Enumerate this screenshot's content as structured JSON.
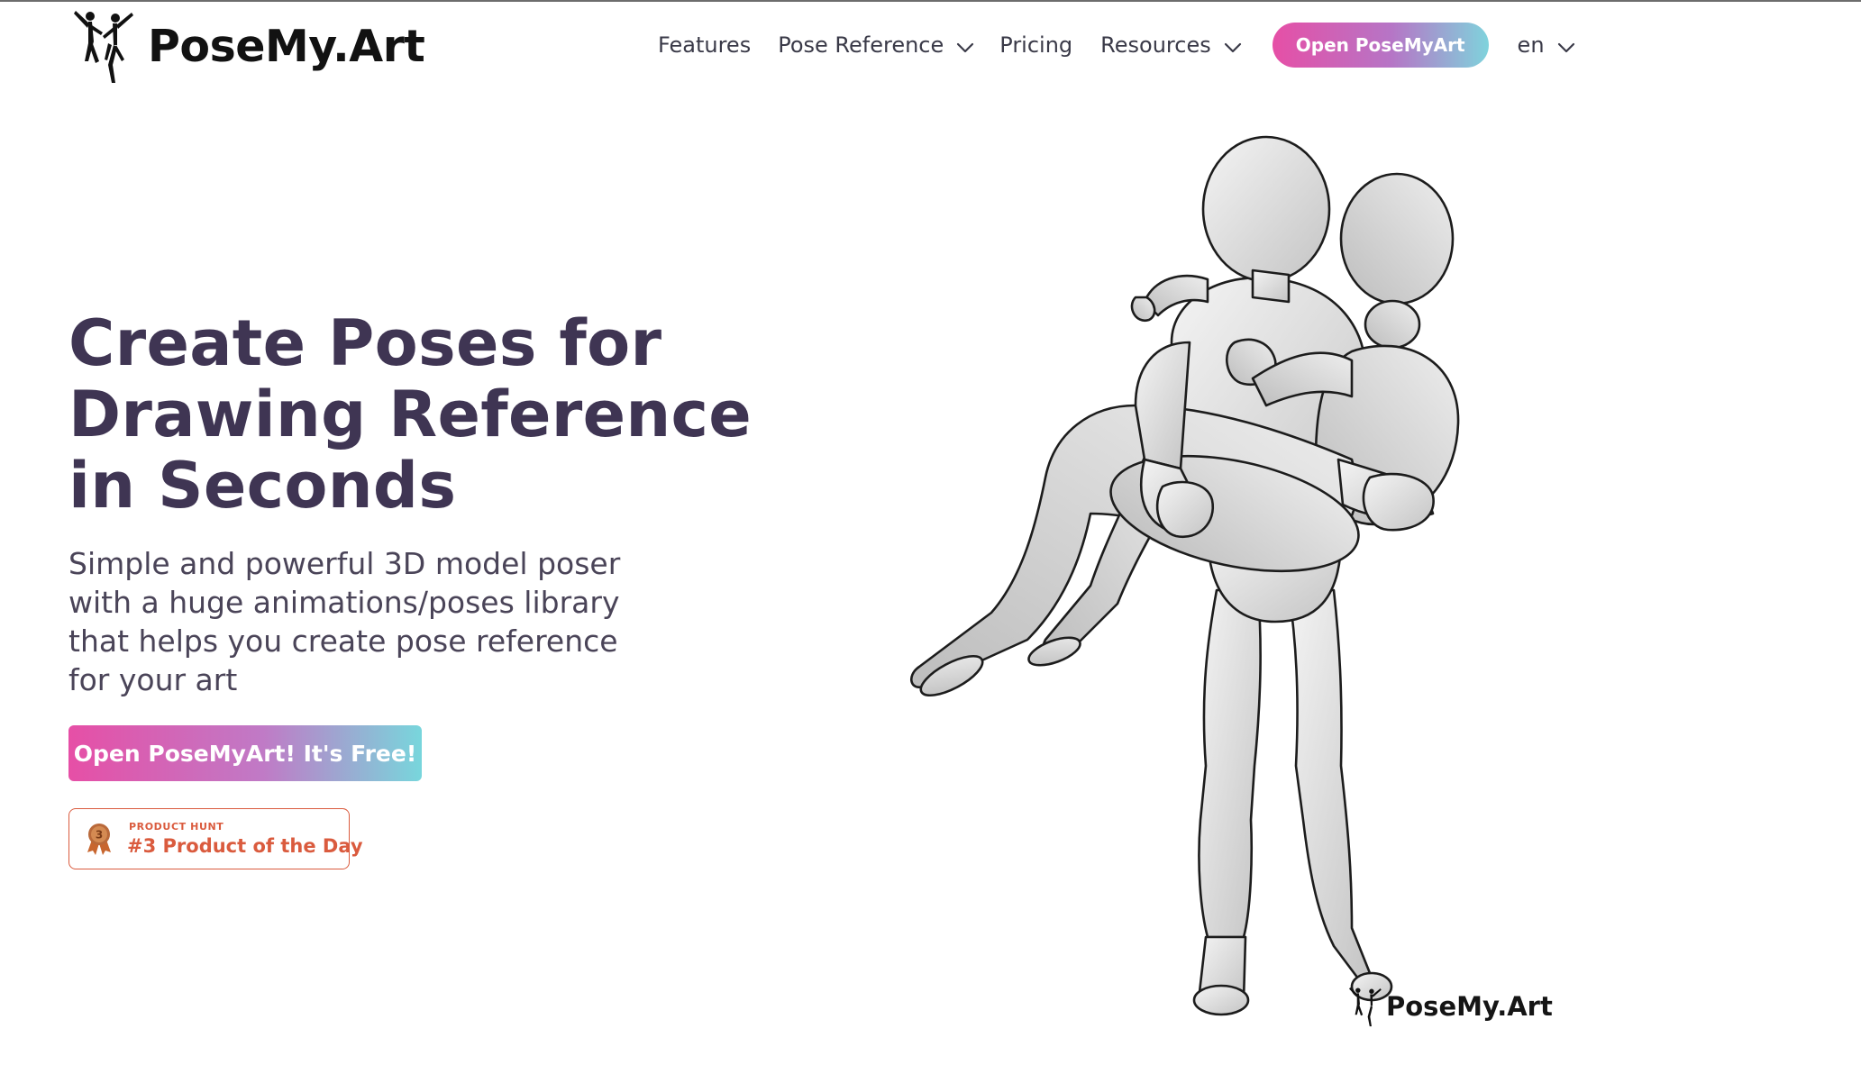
{
  "brand": {
    "name": "PoseMy.Art",
    "logo_icon": "dancing-figures-logo-icon"
  },
  "nav": {
    "features": "Features",
    "pose_reference": "Pose Reference",
    "pricing": "Pricing",
    "resources": "Resources",
    "open_button": "Open PoseMyArt",
    "language": "en"
  },
  "hero": {
    "title_lines": [
      "Create Poses for",
      "Drawing Reference",
      "in Seconds"
    ],
    "subtitle_lines": [
      "Simple and powerful 3D model poser",
      "with a huge animations/poses library",
      "that helps you create pose reference",
      "for your art"
    ],
    "cta": "Open PoseMyArt! It's Free!"
  },
  "product_hunt": {
    "kicker": "PRODUCT HUNT",
    "title": "#3 Product of the Day",
    "medal_number": "3",
    "medal_icon": "bronze-medal-icon"
  },
  "illustration": {
    "subject": "two-mannequins-carry-pose",
    "watermark": "PoseMy.Art"
  },
  "colors": {
    "heading": "#3f3553",
    "accent_pink": "#e64fa6",
    "accent_teal": "#7fd3dc",
    "badge_orange": "#da5b3e"
  }
}
